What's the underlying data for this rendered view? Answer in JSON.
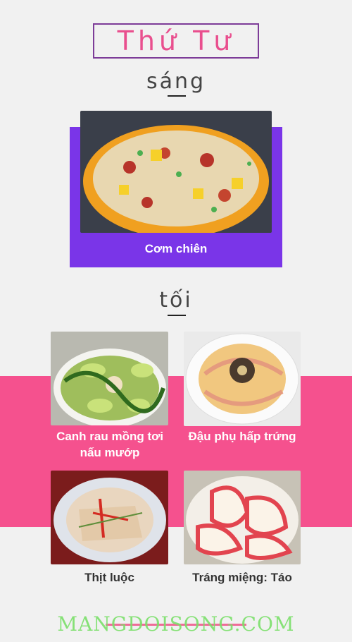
{
  "title": "Thứ Tư",
  "morning": {
    "label": "sáng",
    "dish": {
      "name": "Cơm chiên",
      "image_icon": "fried-rice-in-pineapple-image"
    }
  },
  "evening": {
    "label": "tối",
    "dishes": [
      {
        "name": "Canh rau mồng tơi nấu mướp",
        "image_icon": "vegetable-soup-image"
      },
      {
        "name": "Đậu phụ hấp trứng",
        "image_icon": "steamed-tofu-egg-image"
      },
      {
        "name": "Thịt luộc",
        "image_icon": "boiled-pork-image"
      },
      {
        "name": "Tráng miệng: Táo",
        "image_icon": "apple-slices-image"
      }
    ]
  },
  "watermark": "MANGDOISONG.COM",
  "colors": {
    "purple": "#7a35e8",
    "pink": "#f5518e",
    "title_pink": "#e94f8e",
    "title_border": "#7d3c98",
    "watermark_green": "#7be06a"
  }
}
